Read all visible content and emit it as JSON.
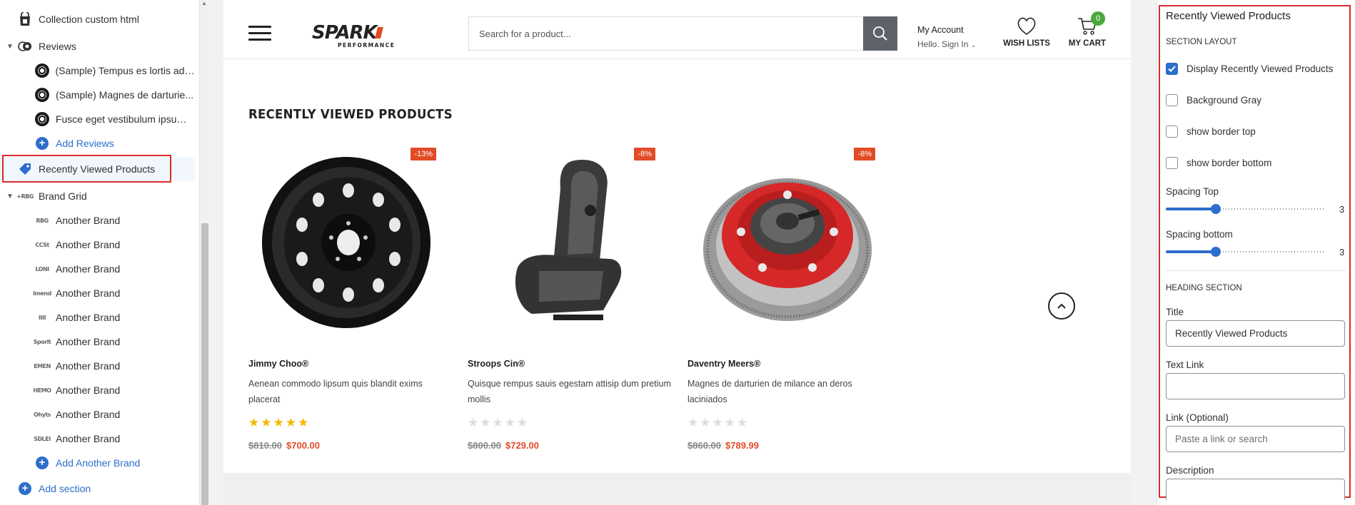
{
  "sidebar": {
    "items": [
      {
        "label": "Collection custom html",
        "level": "root",
        "icon": "bag-icon"
      },
      {
        "label": "Reviews",
        "level": "group",
        "icon": "reviews-icon"
      },
      {
        "label": "(Sample) Tempus es lortis ado...",
        "level": "child",
        "icon": "disc-icon"
      },
      {
        "label": "(Sample) Magnes de darturie...",
        "level": "child",
        "icon": "disc-icon"
      },
      {
        "label": "Fusce eget vestibulum ipsumt...",
        "level": "child",
        "icon": "disc-icon"
      },
      {
        "label": "Add Reviews",
        "level": "add",
        "icon": "plus-icon"
      },
      {
        "label": "Recently Viewed Products",
        "level": "root",
        "icon": "tag-icon"
      },
      {
        "label": "Brand Grid",
        "level": "group",
        "icon": "brand-icon"
      },
      {
        "label": "Another Brand",
        "level": "child",
        "icon": "brand-logo-icon"
      },
      {
        "label": "Another Brand",
        "level": "child",
        "icon": "brand-logo-icon"
      },
      {
        "label": "Another Brand",
        "level": "child",
        "icon": "brand-logo-icon"
      },
      {
        "label": "Another Brand",
        "level": "child",
        "icon": "brand-logo-icon"
      },
      {
        "label": "Another Brand",
        "level": "child",
        "icon": "brand-logo-icon"
      },
      {
        "label": "Another Brand",
        "level": "child",
        "icon": "brand-logo-icon"
      },
      {
        "label": "Another Brand",
        "level": "child",
        "icon": "brand-logo-icon"
      },
      {
        "label": "Another Brand",
        "level": "child",
        "icon": "brand-logo-icon"
      },
      {
        "label": "Another Brand",
        "level": "child",
        "icon": "brand-logo-icon"
      },
      {
        "label": "Another Brand",
        "level": "child",
        "icon": "brand-logo-icon"
      },
      {
        "label": "Add Another Brand",
        "level": "add",
        "icon": "plus-icon"
      },
      {
        "label": "Add section",
        "level": "add-root",
        "icon": "plus-icon"
      }
    ],
    "brand_minis": [
      "RBG",
      "CCSt",
      "LONI",
      "Imend",
      "IIII",
      "Sporit",
      "EMEN",
      "HEMO",
      "Ohyts",
      "SDLEI"
    ]
  },
  "store": {
    "logo_text": "SPARK",
    "logo_sub": "PERFORMANCE",
    "search_placeholder": "Search for a product...",
    "account_title": "My Account",
    "account_sub": "Hello. Sign In",
    "wishlist_label": "WISH LISTS",
    "cart_label": "MY CART",
    "cart_count": "0",
    "section_title": "RECENTLY VIEWED PRODUCTS",
    "products": [
      {
        "brand": "Jimmy Choo®",
        "desc": "Aenean commodo lipsum quis blandit exims placerat",
        "badge": "-13%",
        "old_price": "$810.00",
        "new_price": "$700.00",
        "rating": 5
      },
      {
        "brand": "Stroops Cin®",
        "desc": "Quisque rempus sauis egestam attisip dum pretium mollis",
        "badge": "-8%",
        "old_price": "$800.00",
        "new_price": "$729.00",
        "rating": 0
      },
      {
        "brand": "Daventry Meers®",
        "desc": "Magnes de darturien de milance an deros laciniados",
        "badge": "-8%",
        "old_price": "$860.00",
        "new_price": "$789.99",
        "rating": 0
      }
    ]
  },
  "settings": {
    "title": "Recently Viewed Products",
    "layout_heading": "SECTION LAYOUT",
    "checkboxes": [
      {
        "label": "Display Recently Viewed Products",
        "checked": true
      },
      {
        "label": "Background Gray",
        "checked": false
      },
      {
        "label": "show border top",
        "checked": false
      },
      {
        "label": "show border bottom",
        "checked": false
      }
    ],
    "spacing_top_label": "Spacing Top",
    "spacing_top_value": "3",
    "spacing_bottom_label": "Spacing bottom",
    "spacing_bottom_value": "3",
    "heading_section": "HEADING SECTION",
    "title_label": "Title",
    "title_value": "Recently Viewed Products",
    "text_link_label": "Text Link",
    "text_link_value": "",
    "link_label": "Link (Optional)",
    "link_placeholder": "Paste a link or search",
    "description_label": "Description"
  },
  "colors": {
    "accent": "#2c6ecb",
    "highlight": "#d82c2c",
    "sale": "#e24b26",
    "star": "#f5b800"
  }
}
